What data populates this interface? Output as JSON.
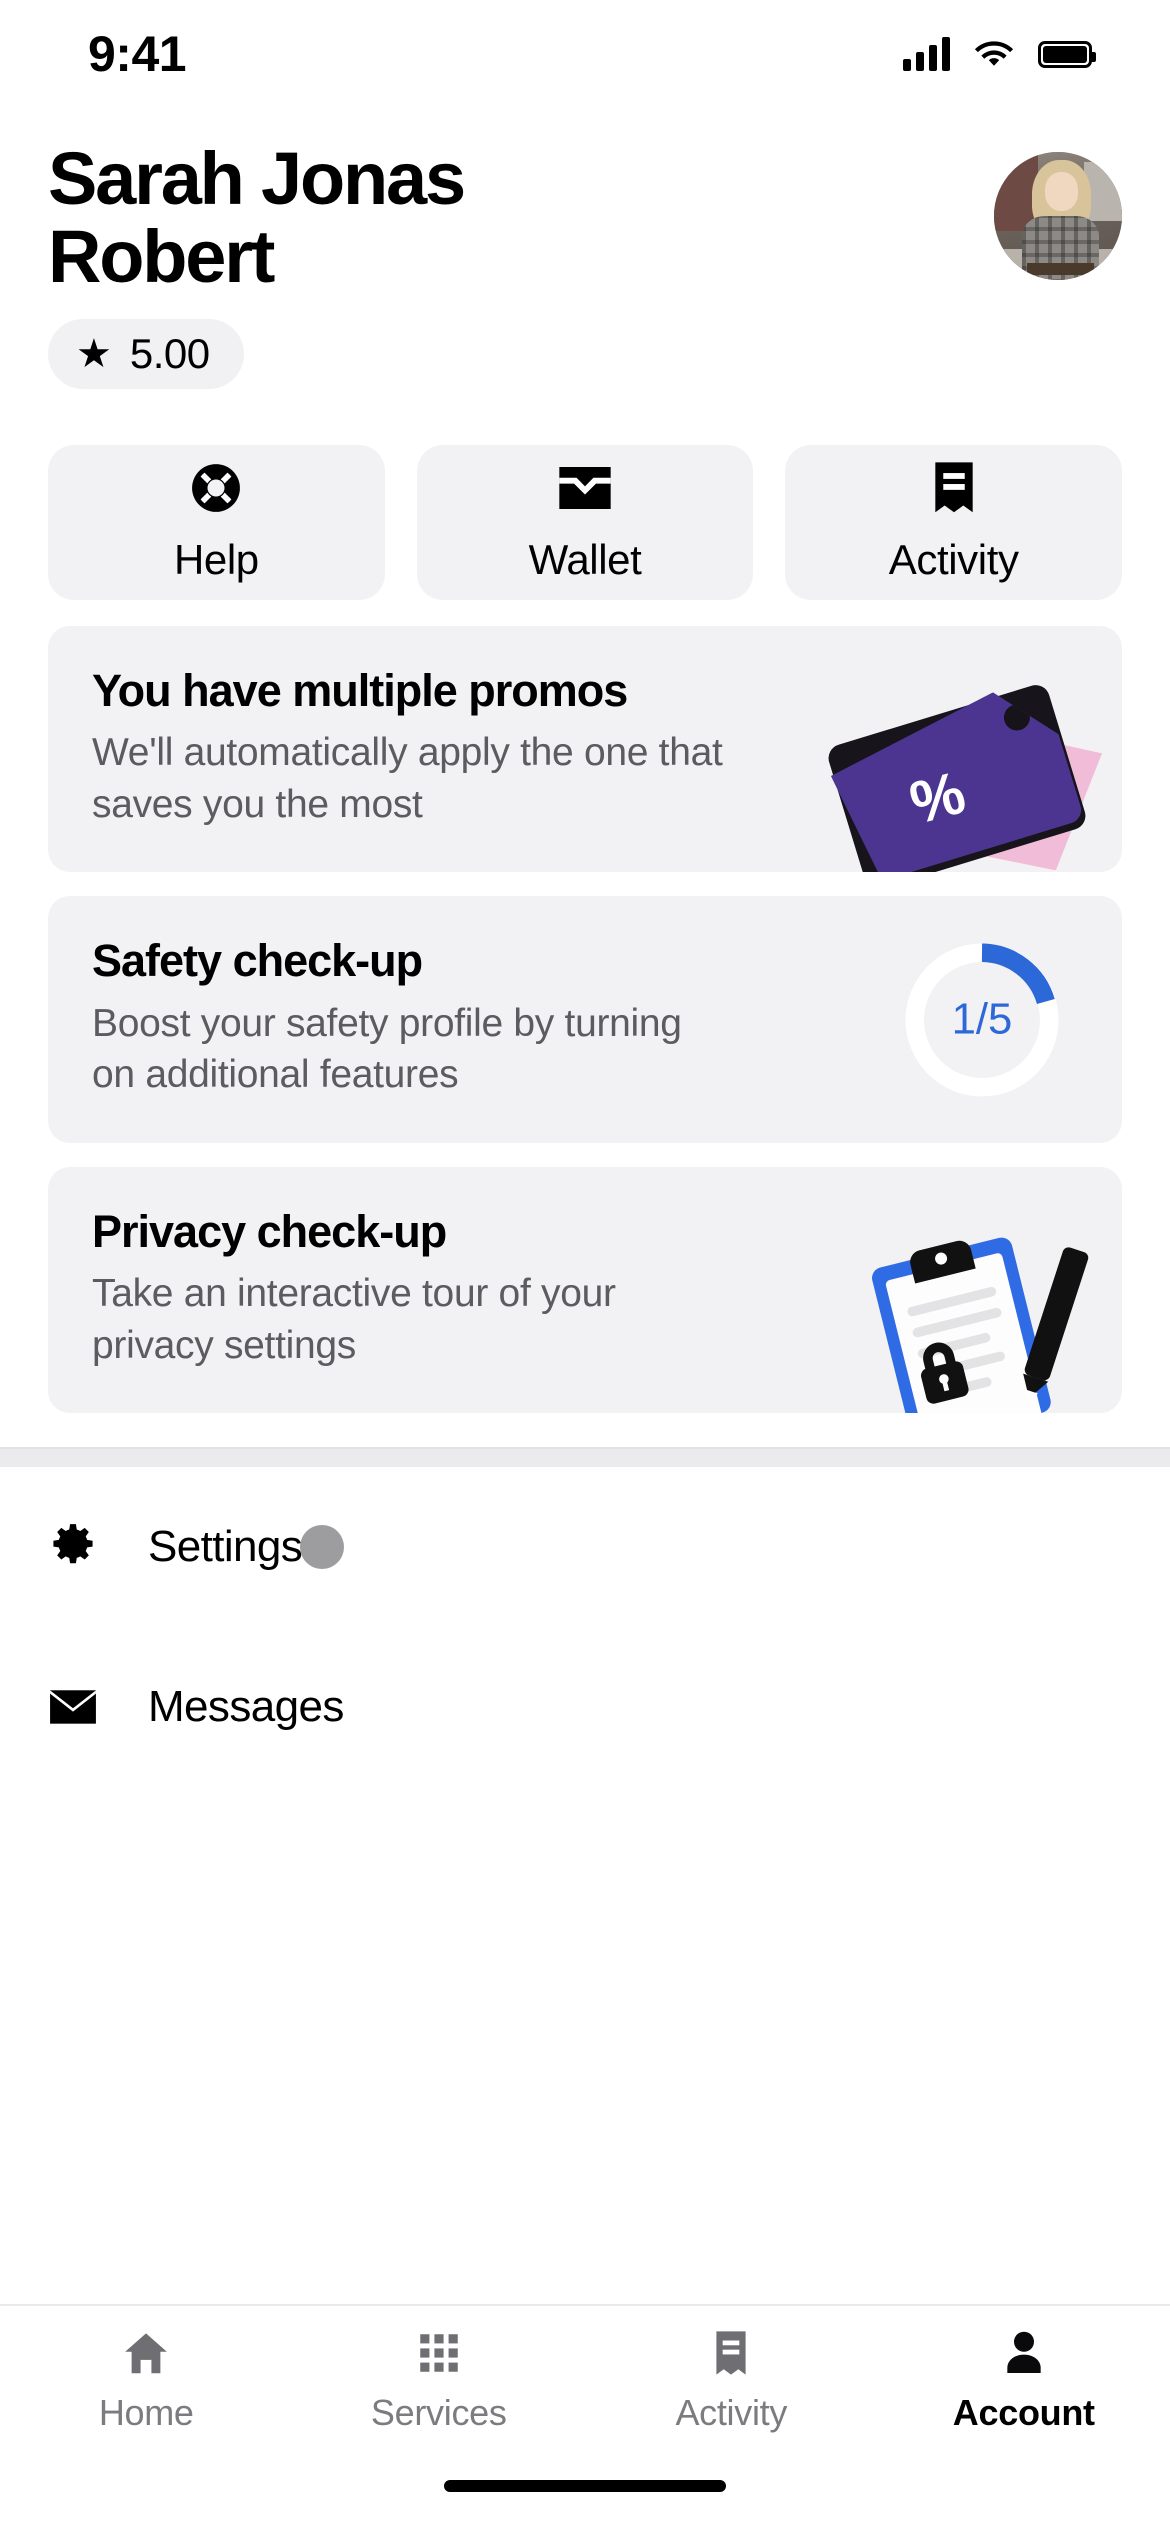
{
  "status_bar": {
    "time": "9:41",
    "signal_icon": "cellular-signal-icon",
    "wifi_icon": "wifi-icon",
    "battery_icon": "battery-icon"
  },
  "header": {
    "name": "Sarah Jonas Robert",
    "avatar_name": "profile-avatar",
    "rating": {
      "star_glyph": "★",
      "value": "5.00"
    }
  },
  "quick_actions": [
    {
      "label": "Help",
      "icon": "life-ring-icon"
    },
    {
      "label": "Wallet",
      "icon": "wallet-icon"
    },
    {
      "label": "Activity",
      "icon": "receipt-icon"
    }
  ],
  "cards": [
    {
      "title": "You have multiple promos",
      "subtitle": "We'll automatically apply the one that saves you the most",
      "art": "promo-tag-illustration",
      "percent_glyph": "%",
      "colors": {
        "tag": "#4B3590",
        "tag_back": "#F0BCD8"
      }
    },
    {
      "title": "Safety check-up",
      "subtitle": "Boost your safety profile by turning on additional features",
      "art": "progress-ring",
      "progress": {
        "current": 1,
        "total": 5,
        "label": "1/5",
        "color": "#2D68D9",
        "track": "#FFFFFF"
      }
    },
    {
      "title": "Privacy check-up",
      "subtitle": "Take an interactive tour of your privacy settings",
      "art": "privacy-clipboard-illustration",
      "colors": {
        "clipboard": "#2F6BE4",
        "paper": "#FFFFFF",
        "clip": "#111111"
      }
    }
  ],
  "menu": [
    {
      "label": "Settings",
      "icon": "gear-icon"
    },
    {
      "label": "Messages",
      "icon": "envelope-icon"
    }
  ],
  "cursor": {
    "name": "touch-cursor-indicator",
    "color": "#9D9DA0"
  },
  "tab_bar": {
    "active": "Account",
    "items": [
      {
        "label": "Home",
        "icon": "home-icon",
        "active": false
      },
      {
        "label": "Services",
        "icon": "grid-icon",
        "active": false
      },
      {
        "label": "Activity",
        "icon": "receipt-icon",
        "active": false
      },
      {
        "label": "Account",
        "icon": "person-icon",
        "active": true
      }
    ]
  },
  "theme": {
    "card_bg": "#F2F1F3",
    "text_primary": "#000000",
    "text_secondary": "#5B5B60",
    "tab_inactive": "#7B7B80",
    "accent_blue": "#2D68D9"
  }
}
